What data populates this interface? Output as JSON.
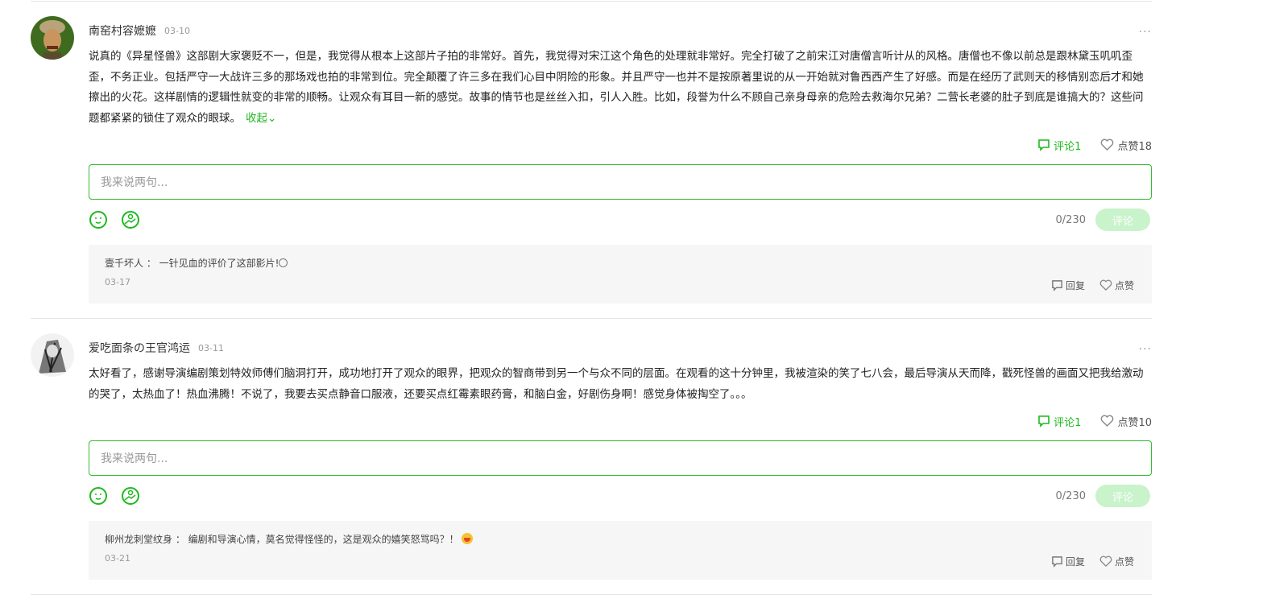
{
  "comments": [
    {
      "user": "南窑村容嬷嬷",
      "date": "03-10",
      "more": "···",
      "text": "说真的《异星怪兽》这部剧大家褒贬不一，但是，我觉得从根本上这部片子拍的非常好。首先，我觉得对宋江这个角色的处理就非常好。完全打破了之前宋江对唐僧言听计从的风格。唐僧也不像以前总是跟林黛玉叽叽歪歪，不务正业。包括严守一大战许三多的那场戏也拍的非常到位。完全颠覆了许三多在我们心目中阴险的形象。并且严守一也并不是按原著里说的从一开始就对鲁西西产生了好感。而是在经历了武则天的移情别恋后才和她擦出的火花。这样剧情的逻辑性就变的非常的顺畅。让观众有耳目一新的感觉。故事的情节也是丝丝入扣，引人入胜。比如，段誉为什么不顾自己亲身母亲的危险去救海尔兄弟？二营长老婆的肚子到底是谁搞大的？这些问题都紧紧的锁住了观众的眼球。",
      "fold": "收起",
      "comment_label": "评论1",
      "like_label": "点赞18",
      "placeholder": "我来说两句...",
      "count": "0/230",
      "send": "评论",
      "reply": {
        "user": "壹千坏人",
        "sep": " ： ",
        "text": "一针见血的评价了这部影片!",
        "date": "03-17",
        "reply_label": "回复",
        "like_label": "点赞"
      }
    },
    {
      "user": "爱吃面条の王官鸿运",
      "date": "03-11",
      "more": "···",
      "text": "太好看了，感谢导演编剧策划特效师傅们脑洞打开，成功地打开了观众的眼界，把观众的智商带到另一个与众不同的层面。在观看的这十分钟里，我被渲染的笑了七八会，最后导演从天而降，戳死怪兽的画面又把我给激动的哭了，太热血了！热血沸腾！不说了，我要去买点静音口服液，还要买点红霉素眼药膏，和脑白金，好剧伤身啊！感觉身体被掏空了。。。",
      "comment_label": "评论1",
      "like_label": "点赞10",
      "placeholder": "我来说两句...",
      "count": "0/230",
      "send": "评论",
      "reply": {
        "user": "柳州龙刺堂纹身",
        "sep": " ： ",
        "text": "编剧和导演心情，莫名觉得怪怪的，这是观众的嬉笑怒骂吗？！",
        "date": "03-21",
        "reply_label": "回复",
        "like_label": "点赞"
      }
    }
  ],
  "colors": {
    "accent": "#1db91d",
    "send_disabled": "#c9f3cb",
    "reply_bg": "#f6f6f6"
  }
}
